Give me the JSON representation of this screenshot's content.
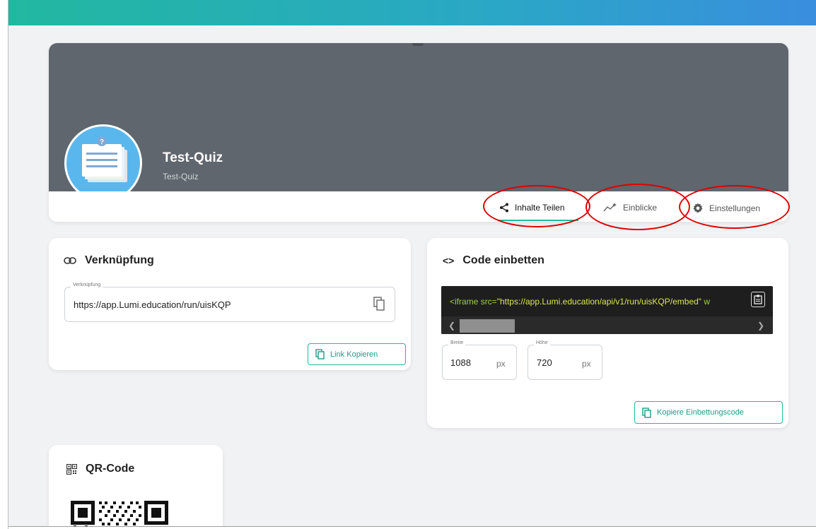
{
  "header": {
    "title": "Test-Quiz",
    "subtitle": "Test-Quiz"
  },
  "tabs": [
    {
      "label": "Inhalte Teilen",
      "icon": "share-icon",
      "active": true
    },
    {
      "label": "Einblicke",
      "icon": "insights-icon",
      "active": false
    },
    {
      "label": "Einstellungen",
      "icon": "gear-icon",
      "active": false
    }
  ],
  "link_card": {
    "title": "Verknüpfung",
    "field_label": "Verknüpfung",
    "url": "https://app.Lumi.education/run/uisKQP",
    "copy_button": "Link Kopieren"
  },
  "embed_card": {
    "title": "Code einbetten",
    "code": {
      "tag_open": "<iframe ",
      "attr": "src=",
      "value": "\"https://app.Lumi.education/api/v1/run/uisKQP/embed\"",
      "trail": " w"
    },
    "width_label": "Breite",
    "width_value": "1088",
    "height_label": "Höhe",
    "height_value": "720",
    "unit": "px",
    "copy_button": "Kopiere Einbettungscode"
  },
  "qr_card": {
    "title": "QR-Code"
  },
  "colors": {
    "accent": "#22b8a0",
    "cover": "#5f666d",
    "avatar": "#5ab7ee",
    "annotation": "#e00000"
  }
}
